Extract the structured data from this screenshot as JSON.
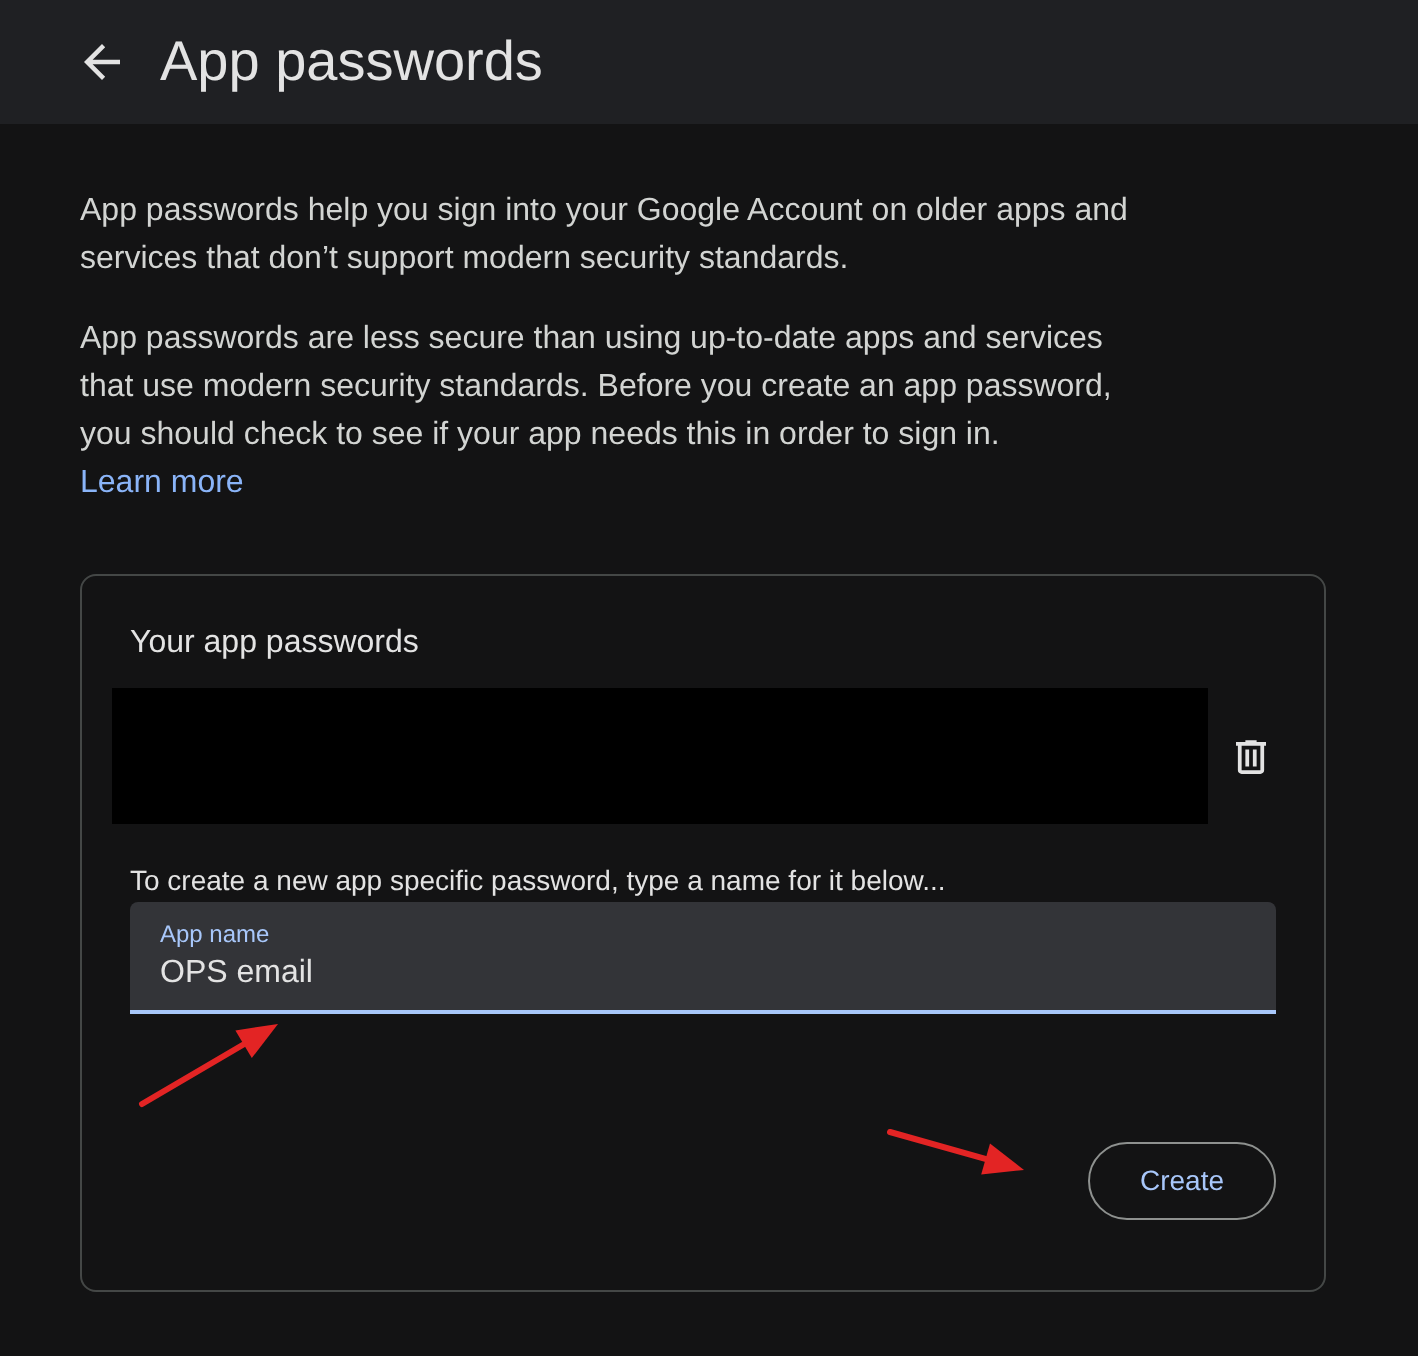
{
  "header": {
    "title": "App passwords"
  },
  "intro": [
    "App passwords help you sign into your Google Account on older apps and services that don’t support modern security standards.",
    "App passwords are less secure than using up-to-date apps and services that use modern security standards. Before you create an app password, you should check to see if your app needs this in order to sign in."
  ],
  "learn_more_link": "Learn more",
  "card": {
    "title": "Your app passwords",
    "passwords": [
      {
        "redacted": true
      }
    ],
    "instructions": "To create a new app specific password, type a name for it below...",
    "app_name_field": {
      "label": "App name",
      "value": "OPS email",
      "focused": true
    },
    "create_button": "Create"
  }
}
